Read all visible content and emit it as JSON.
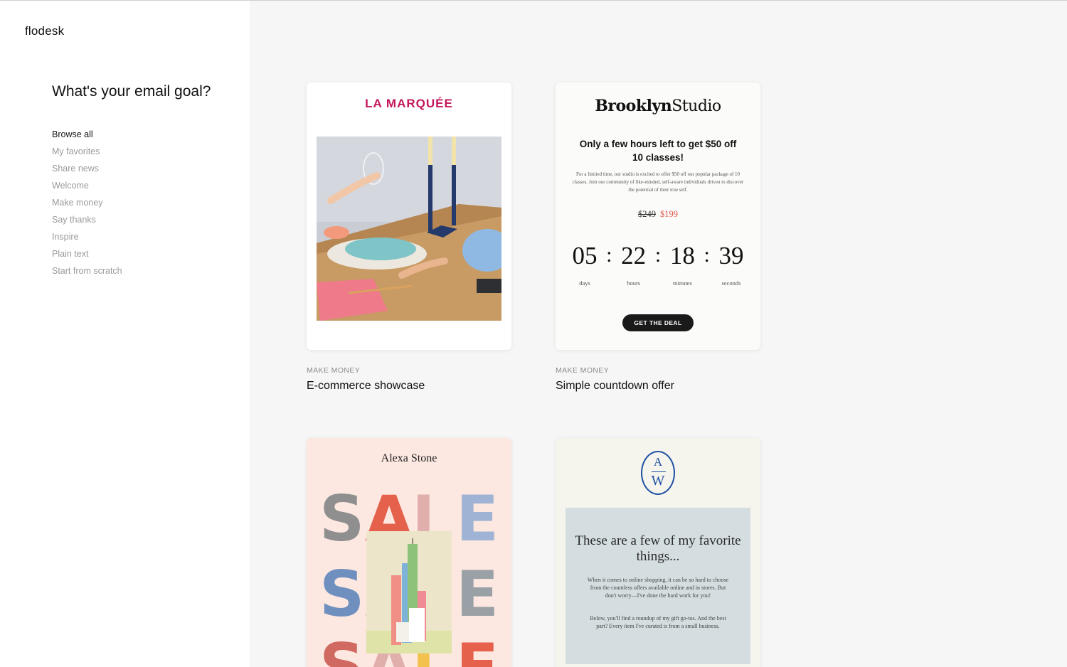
{
  "app": {
    "logo": "flodesk"
  },
  "sidebar": {
    "title": "What's your email goal?",
    "items": [
      {
        "label": "Browse all",
        "active": true
      },
      {
        "label": "My favorites",
        "active": false
      },
      {
        "label": "Share news",
        "active": false
      },
      {
        "label": "Welcome",
        "active": false
      },
      {
        "label": "Make money",
        "active": false
      },
      {
        "label": "Say thanks",
        "active": false
      },
      {
        "label": "Inspire",
        "active": false
      },
      {
        "label": "Plain text",
        "active": false
      },
      {
        "label": "Start from scratch",
        "active": false
      }
    ]
  },
  "templates": [
    {
      "category": "MAKE MONEY",
      "name": "E-commerce showcase",
      "brand": "LA MARQUÉE"
    },
    {
      "category": "MAKE MONEY",
      "name": "Simple countdown offer",
      "brand_bold": "Brooklyn",
      "brand_light": "Studio",
      "headline": "Only a few hours left to get $50 off 10 classes!",
      "body": "For a limited time, our studio is excited to offer $50 off our popular package of 10 classes. Join our community of like-minded, self-aware individuals driven to discover the potential of their true self.",
      "old_price": "$249",
      "new_price": "$199",
      "countdown": [
        {
          "value": "05",
          "label": "days"
        },
        {
          "value": "22",
          "label": "hours"
        },
        {
          "value": "18",
          "label": "minutes"
        },
        {
          "value": "39",
          "label": "seconds"
        }
      ],
      "separator": ":",
      "cta": "GET THE DEAL"
    },
    {
      "brand": "Alexa Stone",
      "sale_rows": [
        [
          "S",
          "A",
          "L",
          "E"
        ],
        [
          "S",
          "A",
          "L",
          "E"
        ],
        [
          "S",
          "A",
          "L",
          "E"
        ]
      ]
    },
    {
      "monogram_top": "A",
      "monogram_bottom": "W",
      "title": "These are a few of my favorite things...",
      "body_1": "When it comes to online shopping, it can be so hard to choose from the countless offers available online and in stores. But don't worry—I've done the hard work for you!",
      "body_2": "Below, you'll find a roundup of my gift go-tos. And the best part? Every item I've curated is from a small business."
    }
  ],
  "colors": {
    "brand_pink": "#c2185b",
    "sale_price": "#e0584a",
    "monogram_blue": "#1f4fa3",
    "sale_letters": [
      "#8f8f8f",
      "#e5614c",
      "#e0aeab",
      "#9fb4d4",
      "#6f8fbf",
      "#f2b8a8",
      "#d06a60",
      "#9aa1a6"
    ]
  }
}
